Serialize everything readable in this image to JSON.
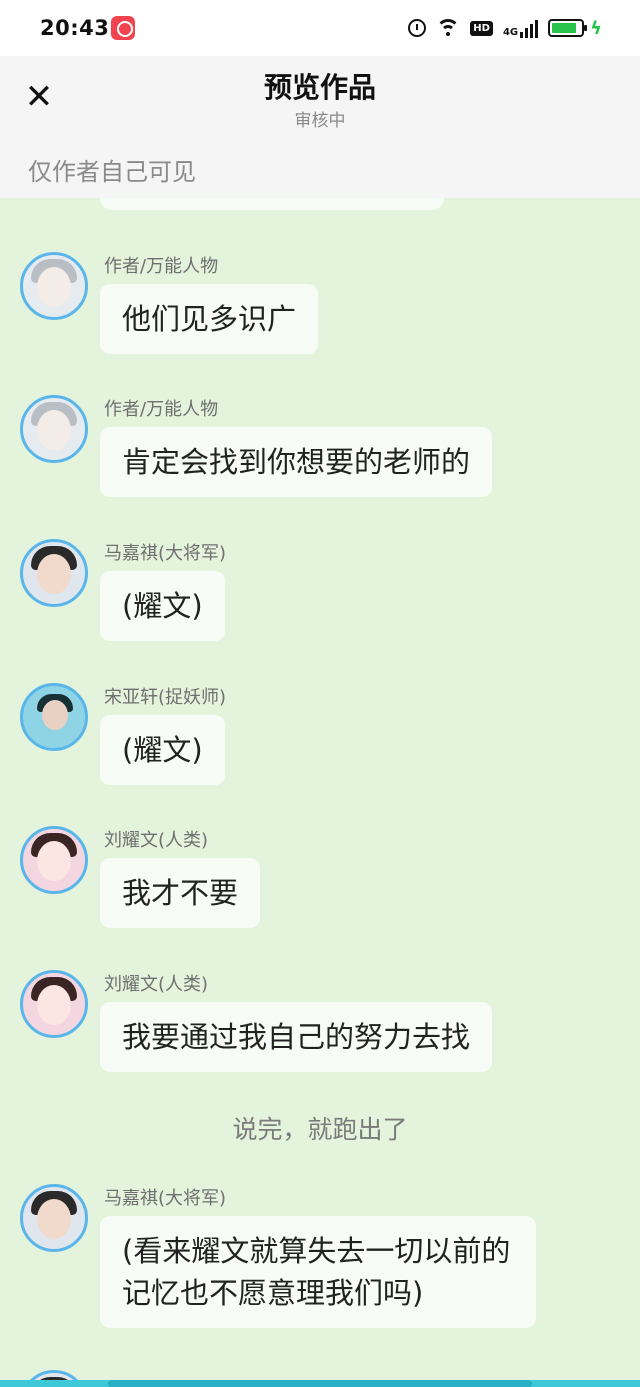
{
  "status_bar": {
    "time": "20:43",
    "network": "4G",
    "hd": "HD"
  },
  "header": {
    "title": "预览作品",
    "subtitle": "审核中",
    "visibility": "仅作者自己可见"
  },
  "messages": [
    {
      "name": "作者/万能人物",
      "text": "他们见多识广"
    },
    {
      "name": "作者/万能人物",
      "text": "肯定会找到你想要的老师的"
    },
    {
      "name": "马嘉祺(大将军)",
      "text": "(耀文)"
    },
    {
      "name": "宋亚轩(捉妖师)",
      "text": "(耀文)"
    },
    {
      "name": "刘耀文(人类)",
      "text": "我才不要"
    },
    {
      "name": "刘耀文(人类)",
      "text": "我要通过我自己的努力去找"
    }
  ],
  "narration": "说完，就跑出了",
  "last_message": {
    "name": "马嘉祺(大将军)",
    "text": "(看来耀文就算失去一切以前的记忆也不愿意理我们吗)"
  }
}
